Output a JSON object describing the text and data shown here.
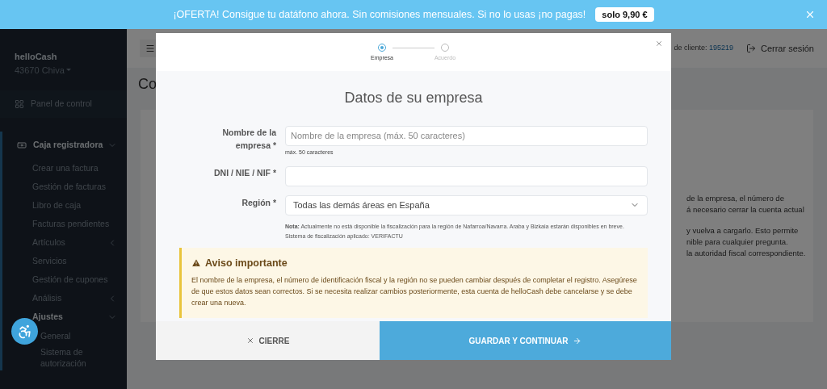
{
  "banner": {
    "text": "¡OFERTA! Consigue tu datáfono ahora. Sin comisiones mensuales. Si no lo usas ¡no pagas!",
    "price": "solo 9,90 €"
  },
  "sidebar": {
    "account_name": "helloCash",
    "location": "43670 Chiva",
    "items": [
      {
        "label": "Panel de control"
      },
      {
        "label": "Caja registradora",
        "expanded": true,
        "children": [
          {
            "label": "Crear una factura"
          },
          {
            "label": "Gestión de facturas"
          },
          {
            "label": "Libro de caja"
          },
          {
            "label": "Facturas pendientes"
          },
          {
            "label": "Artículos",
            "expanded": false
          },
          {
            "label": "Servicios"
          },
          {
            "label": "Gestión de cupones"
          },
          {
            "label": "Análisis",
            "expanded": false
          },
          {
            "label": "Ajustes",
            "expanded": true,
            "children": [
              {
                "label": "General"
              },
              {
                "label": "Sistema de autorización"
              }
            ]
          }
        ]
      }
    ]
  },
  "header": {
    "customer_label": "de cliente:",
    "customer_number": "195219",
    "logout": "Cerrar sesión"
  },
  "page": {
    "title": "Co",
    "card_lines": [
      "de la empresa, el número de",
      "á necesario cerrar la cuenta actual",
      "y vuelva a cargarlo. Esto permite",
      "nible para cualquier pregunta.",
      "la autoridad fiscal correspondiente."
    ]
  },
  "modal": {
    "steps": [
      {
        "label": "Empresa",
        "selected": true
      },
      {
        "label": "Acuerdo",
        "selected": false
      }
    ],
    "title": "Datos de su empresa",
    "fields": [
      {
        "kind": "text",
        "label": "Nombre de la empresa *",
        "placeholder": "Nombre de la empresa (máx. 50 caracteres)",
        "hint": "máx. 50 caracteres"
      },
      {
        "kind": "text",
        "label": "DNI / NIE / NIF *"
      },
      {
        "kind": "select",
        "label": "Región *",
        "value": "Todas las demás áreas en España",
        "note": "**Nota:** Actualmente no está disponible la fiscalización para la región de Nafarroa/Navarra. Araba y Bizkaia estarán disponibles en breve.",
        "note_2": "Sistema de fiscalización aplicado: VERIFACTU"
      }
    ],
    "warning": {
      "title": "Aviso importante",
      "text": "El nombre de la empresa, el número de identificación fiscal y la región no se pueden cambiar después de completar el registro. Asegúrese de que estos datos sean correctos. Si se necesita realizar cambios posteriormente, esta cuenta de helloCash debe cancelarse y se debe crear una nueva."
    },
    "cancel": "CIERRE",
    "submit": "GUARDAR Y CONTINUAR"
  }
}
